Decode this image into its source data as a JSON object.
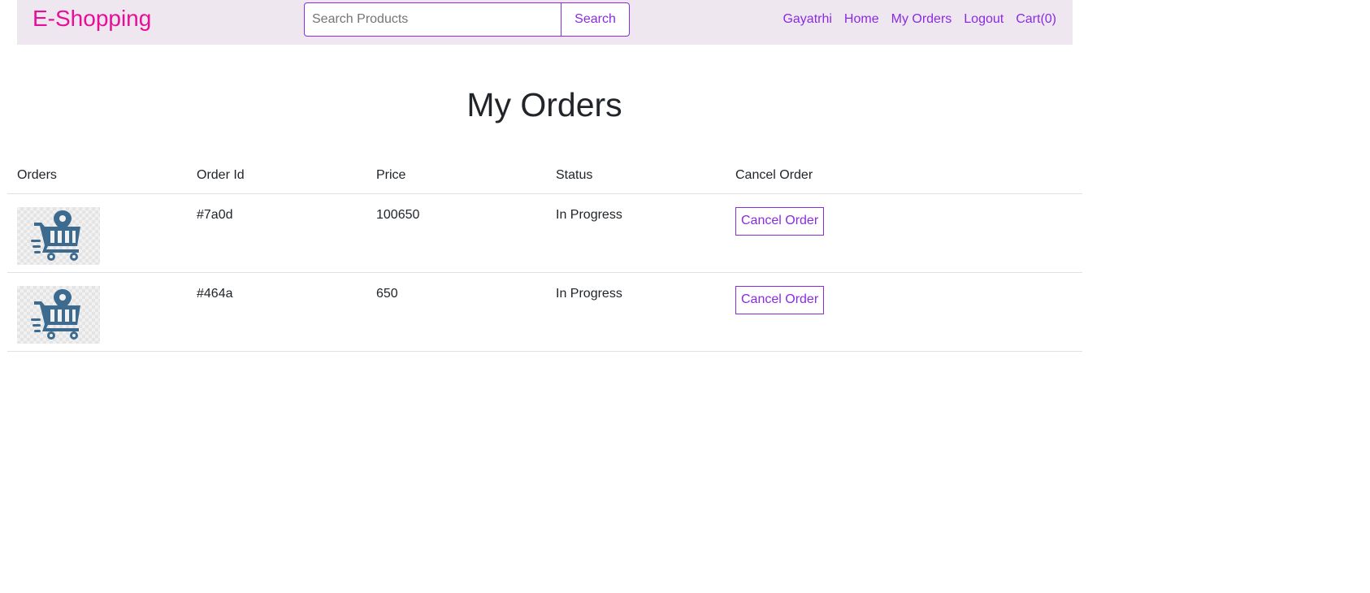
{
  "app": {
    "brand": "E-Shopping"
  },
  "search": {
    "placeholder": "Search Products",
    "value": "",
    "button_label": "Search"
  },
  "nav": {
    "items": [
      {
        "label": "Gayatrhi"
      },
      {
        "label": "Home"
      },
      {
        "label": "My Orders"
      },
      {
        "label": "Logout"
      },
      {
        "label": "Cart(0)"
      }
    ]
  },
  "page": {
    "title": "My Orders"
  },
  "table": {
    "headers": [
      "Orders",
      "Order Id",
      "Price",
      "Status",
      "Cancel Order"
    ],
    "rows": [
      {
        "image": "shopping-cart-icon",
        "order_id": "#7a0d",
        "price": "100650",
        "status": "In Progress",
        "action": "Cancel Order"
      },
      {
        "image": "shopping-cart-icon",
        "order_id": "#464a",
        "price": "650",
        "status": "In Progress",
        "action": "Cancel Order"
      }
    ]
  },
  "colors": {
    "brand": "#e60f98",
    "accent": "#8a2be2",
    "navbar_bg": "#efe7ef",
    "icon": "#3d6b90"
  }
}
